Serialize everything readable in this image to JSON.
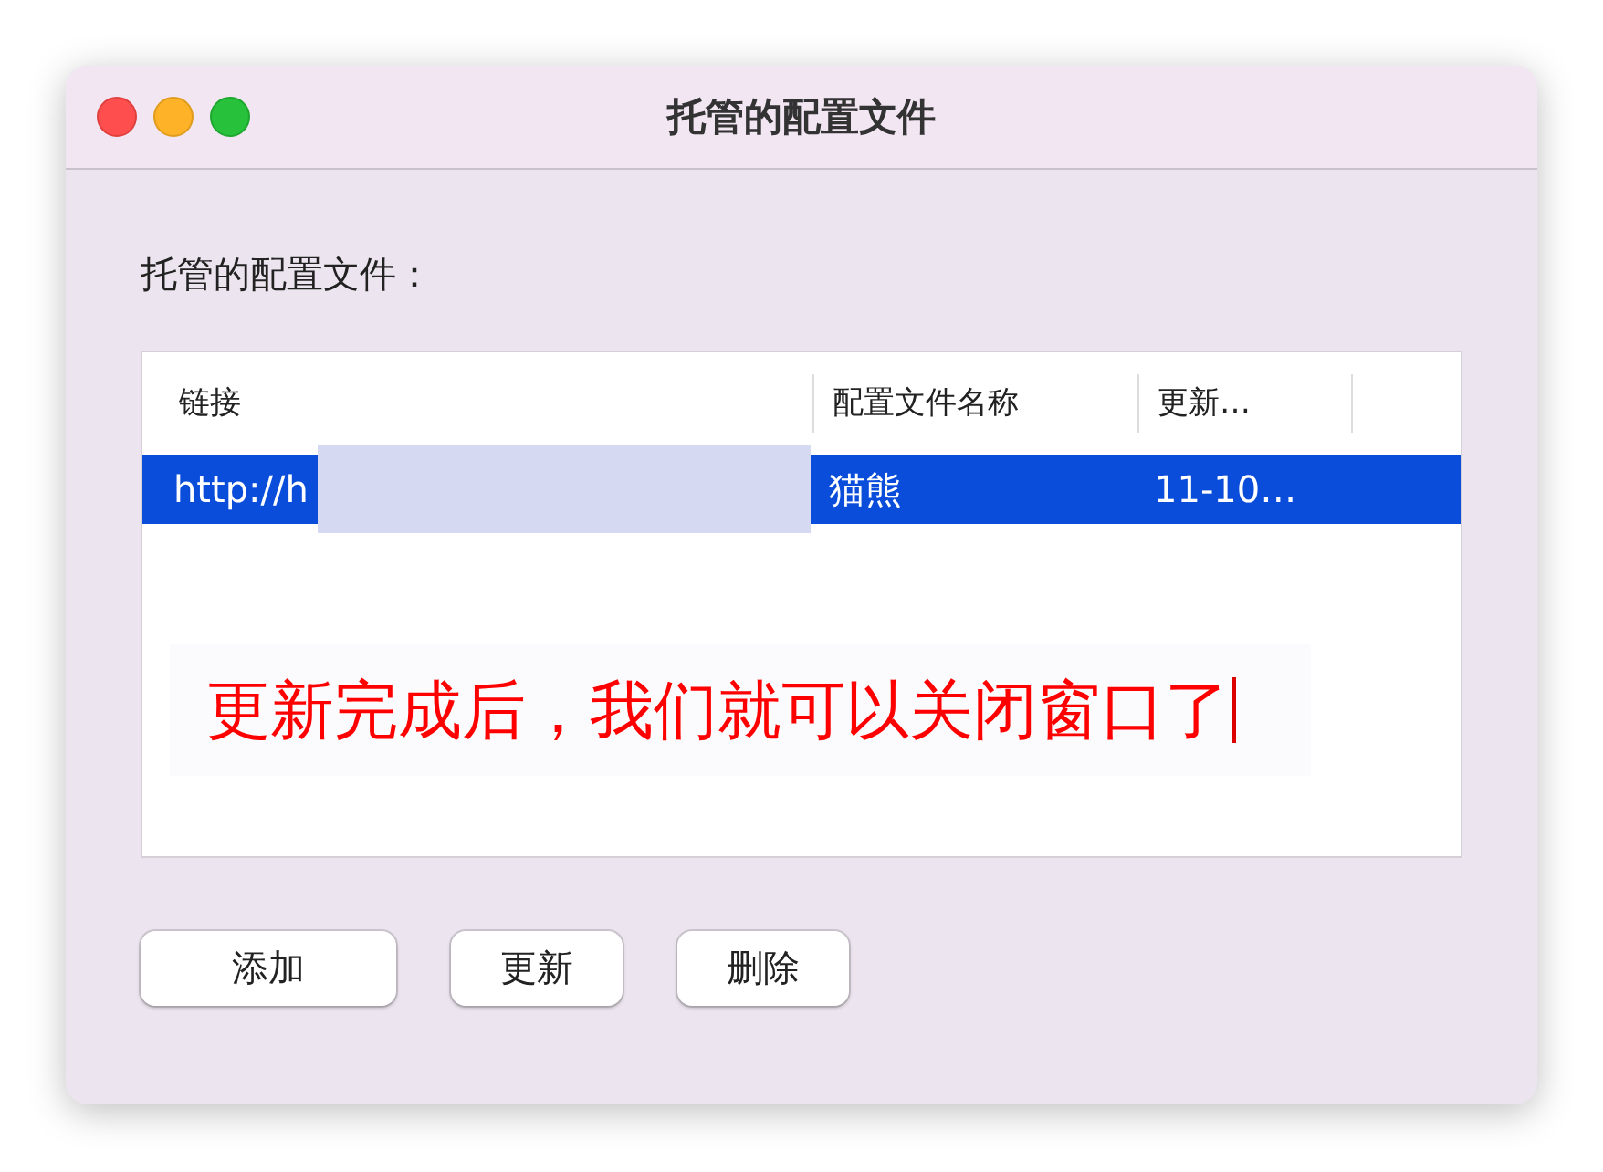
{
  "window": {
    "title": "托管的配置文件"
  },
  "section_label": "托管的配置文件：",
  "table": {
    "columns": [
      "链接",
      "配置文件名称",
      "更新…"
    ],
    "rows": [
      {
        "cells": [
          "http://h",
          "猫熊",
          "11-10…"
        ],
        "selected": true,
        "redacted": true
      }
    ]
  },
  "annotation": {
    "text": "更新完成后，我们就可以关闭窗口了",
    "caret": true
  },
  "buttons": [
    "添加",
    "更新",
    "删除"
  ]
}
